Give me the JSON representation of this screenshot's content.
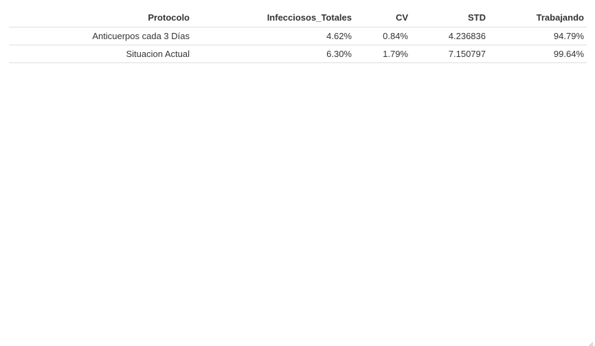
{
  "table": {
    "columns": [
      "Protocolo",
      "Infecciosos_Totales",
      "CV",
      "STD",
      "Trabajando"
    ],
    "rows": [
      [
        "Anticuerpos cada 3 Días",
        "4.62%",
        "0.84%",
        "4.236836",
        "94.79%"
      ],
      [
        "Situacion Actual",
        "6.30%",
        "1.79%",
        "7.150797",
        "99.64%"
      ]
    ]
  },
  "icons": {
    "resize_grip": "resize-grip-icon"
  }
}
